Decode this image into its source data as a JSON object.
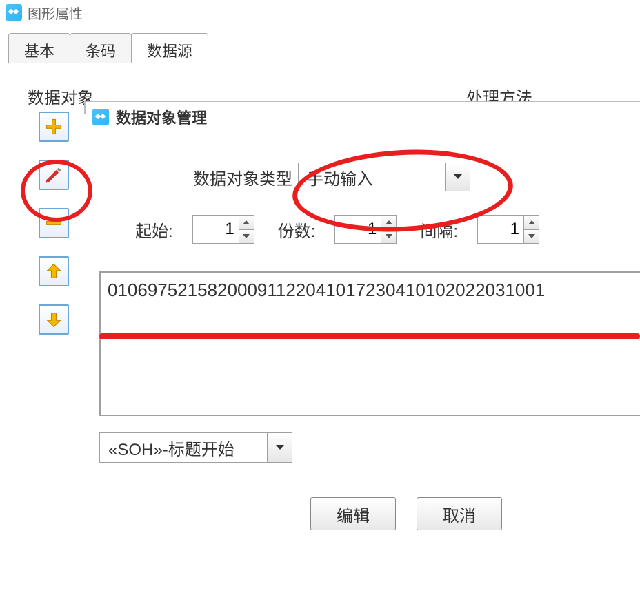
{
  "window": {
    "title": "图形属性"
  },
  "tabs": {
    "basic": "基本",
    "barcode": "条码",
    "datasource": "数据源"
  },
  "groups": {
    "data_object": "数据对象",
    "process_method": "处理方法"
  },
  "dialog": {
    "title": "数据对象管理",
    "type_label": "数据对象类型",
    "type_value": "手动输入",
    "start_label": "起始:",
    "start_value": "1",
    "copies_label": "份数:",
    "copies_value": "1",
    "interval_label": "间隔:",
    "interval_value": "1",
    "textarea_value": "0106975215820009112204101723041010202203100​1",
    "soh_value": "«SOH»-标题开始",
    "edit_button": "编辑",
    "cancel_button": "取消"
  },
  "icons": {
    "add": "plus-icon",
    "edit": "pencil-icon",
    "remove": "minus-icon",
    "up": "arrow-up-icon",
    "down": "arrow-down-icon"
  }
}
